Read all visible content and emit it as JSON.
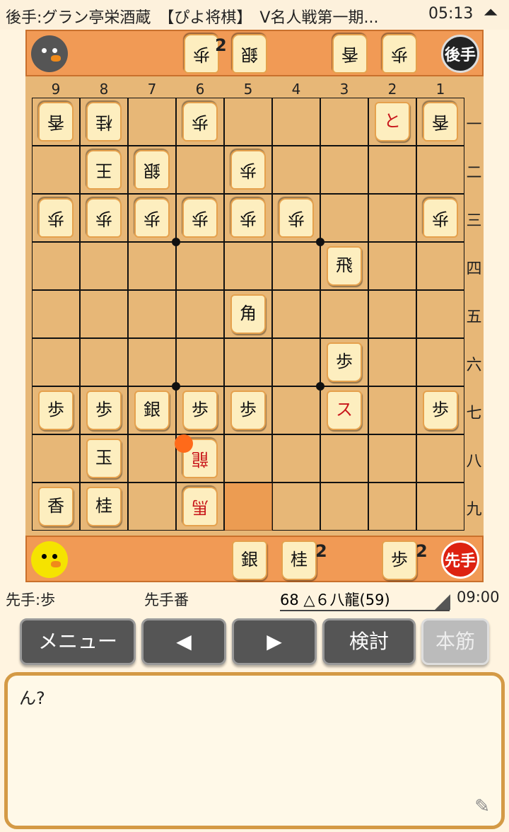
{
  "header": {
    "title": "後手:グラン亭栄酒蔵　【ぴよ将棋】　V名人戦第一期...",
    "clock": "05:13",
    "arrow": "⏶"
  },
  "gote_stand": {
    "badge": "後手",
    "pieces": [
      "歩",
      "2",
      "銀",
      "香",
      "歩"
    ]
  },
  "sente_stand": {
    "badge": "先手",
    "pieces": [
      "銀",
      "桂",
      "2",
      "歩",
      "2"
    ]
  },
  "board": {
    "col_labels": [
      "9",
      "8",
      "7",
      "6",
      "5",
      "4",
      "3",
      "2",
      "1"
    ],
    "row_labels": [
      "一",
      "二",
      "三",
      "四",
      "五",
      "六",
      "七",
      "八",
      "九"
    ],
    "pieces": [
      {
        "kanji": "香",
        "side": "gote",
        "col": 0,
        "row": 0
      },
      {
        "kanji": "桂",
        "side": "gote",
        "col": 1,
        "row": 0
      },
      {
        "kanji": "歩",
        "side": "gote",
        "col": 3,
        "row": 0
      },
      {
        "kanji": "と",
        "side": "sente",
        "col": 7,
        "row": 0,
        "red": true
      },
      {
        "kanji": "香",
        "side": "gote",
        "col": 8,
        "row": 0
      },
      {
        "kanji": "王",
        "side": "gote",
        "col": 1,
        "row": 1
      },
      {
        "kanji": "銀",
        "side": "gote",
        "col": 2,
        "row": 1
      },
      {
        "kanji": "歩",
        "side": "gote",
        "col": 4,
        "row": 1
      },
      {
        "kanji": "歩",
        "side": "gote",
        "col": 0,
        "row": 2
      },
      {
        "kanji": "歩",
        "side": "gote",
        "col": 1,
        "row": 2
      },
      {
        "kanji": "歩",
        "side": "gote",
        "col": 2,
        "row": 2
      },
      {
        "kanji": "歩",
        "side": "gote",
        "col": 3,
        "row": 2
      },
      {
        "kanji": "歩",
        "side": "gote",
        "col": 4,
        "row": 2
      },
      {
        "kanji": "歩",
        "side": "gote",
        "col": 5,
        "row": 2
      },
      {
        "kanji": "歩",
        "side": "gote",
        "col": 8,
        "row": 2
      },
      {
        "kanji": "飛",
        "side": "sente",
        "col": 6,
        "row": 3
      },
      {
        "kanji": "角",
        "side": "sente",
        "col": 4,
        "row": 4
      },
      {
        "kanji": "歩",
        "side": "sente",
        "col": 6,
        "row": 5
      },
      {
        "kanji": "歩",
        "side": "sente",
        "col": 0,
        "row": 6
      },
      {
        "kanji": "歩",
        "side": "sente",
        "col": 1,
        "row": 6
      },
      {
        "kanji": "銀",
        "side": "sente",
        "col": 2,
        "row": 6
      },
      {
        "kanji": "歩",
        "side": "sente",
        "col": 3,
        "row": 6
      },
      {
        "kanji": "歩",
        "side": "sente",
        "col": 4,
        "row": 6
      },
      {
        "kanji": "ス",
        "side": "sente",
        "col": 6,
        "row": 6,
        "red": true
      },
      {
        "kanji": "歩",
        "side": "sente",
        "col": 8,
        "row": 6
      },
      {
        "kanji": "玉",
        "side": "sente",
        "col": 1,
        "row": 7
      },
      {
        "kanji": "龍",
        "side": "gote",
        "col": 3,
        "row": 7,
        "red": true
      },
      {
        "kanji": "香",
        "side": "sente",
        "col": 0,
        "row": 8
      },
      {
        "kanji": "桂",
        "side": "sente",
        "col": 1,
        "row": 8
      },
      {
        "kanji": "馬",
        "side": "gote",
        "col": 3,
        "row": 8,
        "red": true
      }
    ]
  },
  "status": {
    "hand": "先手:歩",
    "turn": "先手番",
    "move": "68 △６八龍(59)",
    "time": "09:00"
  },
  "buttons": {
    "menu": "メニュー",
    "prev": "◀",
    "next": "▶",
    "review": "検討",
    "mainline": "本筋"
  },
  "message": {
    "text": "ん?"
  },
  "colors": {
    "last_move": "#f08a3a",
    "highlight": "#ff6a1a",
    "stand": "#f19a55",
    "board": "#e7b777"
  }
}
